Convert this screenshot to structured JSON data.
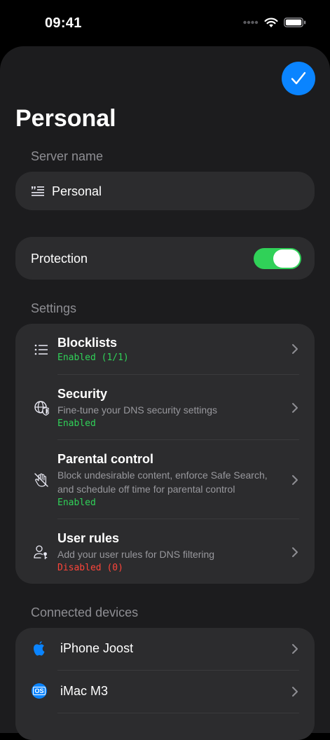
{
  "status_bar": {
    "time": "09:41"
  },
  "header": {
    "title": "Personal"
  },
  "server_name": {
    "label": "Server name",
    "value": "Personal"
  },
  "protection": {
    "label": "Protection",
    "enabled": true
  },
  "settings": {
    "label": "Settings",
    "items": [
      {
        "title": "Blocklists",
        "description": "",
        "status": "Enabled (1/1)",
        "status_color": "#30d158",
        "icon": "list-icon"
      },
      {
        "title": "Security",
        "description": "Fine-tune your DNS security settings",
        "status": "Enabled",
        "status_color": "#30d158",
        "icon": "globe-shield-icon"
      },
      {
        "title": "Parental control",
        "description": "Block undesirable content, enforce Safe Search, and schedule off time for parental control",
        "status": "Enabled",
        "status_color": "#30d158",
        "icon": "hand-slash-icon"
      },
      {
        "title": "User rules",
        "description": "Add your user rules for DNS filtering",
        "status": "Disabled (0)",
        "status_color": "#ff453a",
        "icon": "person-key-icon"
      }
    ]
  },
  "connected_devices": {
    "label": "Connected devices",
    "items": [
      {
        "name": "iPhone Joost",
        "icon": "apple-icon"
      },
      {
        "name": "iMac M3",
        "icon": "macos-icon",
        "badge": "OS"
      }
    ]
  },
  "colors": {
    "accent": "#0a84ff",
    "toggle_on": "#30d158",
    "enabled": "#30d158",
    "disabled": "#ff453a"
  }
}
